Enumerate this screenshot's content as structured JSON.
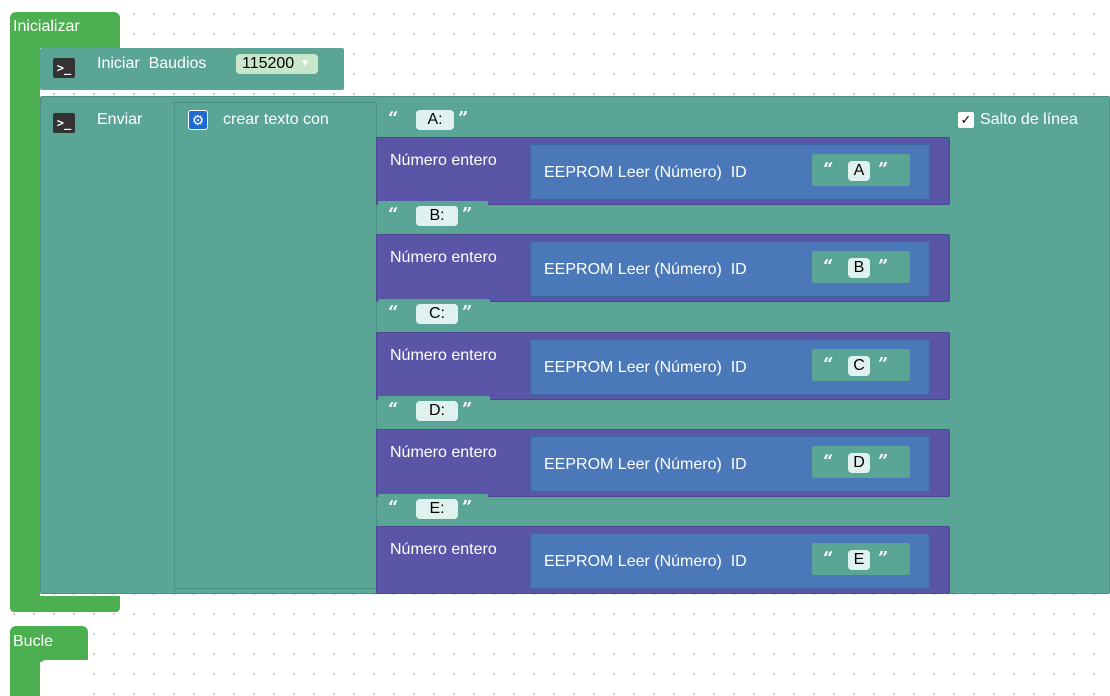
{
  "init_block": {
    "label": "Inicializar"
  },
  "baud": {
    "label": "Iniciar  Baudios",
    "value": "115200",
    "icon": "console-icon"
  },
  "send": {
    "label": "Enviar",
    "newline_label": "Salto de línea",
    "newline_checked": "✓"
  },
  "create_text": {
    "label": "crear texto con",
    "icon": "gear-icon"
  },
  "items": [
    {
      "text": "A:",
      "int_label": "Número entero",
      "eeprom_label": "EEPROM Leer (Número)  ID",
      "id": "A"
    },
    {
      "text": "B:",
      "int_label": "Número entero",
      "eeprom_label": "EEPROM Leer (Número)  ID",
      "id": "B"
    },
    {
      "text": "C:",
      "int_label": "Número entero",
      "eeprom_label": "EEPROM Leer (Número)  ID",
      "id": "C"
    },
    {
      "text": "D:",
      "int_label": "Número entero",
      "eeprom_label": "EEPROM Leer (Número)  ID",
      "id": "D"
    },
    {
      "text": "E:",
      "int_label": "Número entero",
      "eeprom_label": "EEPROM Leer (Número)  ID",
      "id": "E"
    }
  ],
  "loop_block": {
    "label": "Bucle"
  },
  "quote_open": "“",
  "quote_close": "”",
  "colors": {
    "setup_green": "#4caf50",
    "serial_teal": "#5ba597",
    "number_purple": "#5b55a7",
    "eeprom_blue": "#4a78b8"
  }
}
